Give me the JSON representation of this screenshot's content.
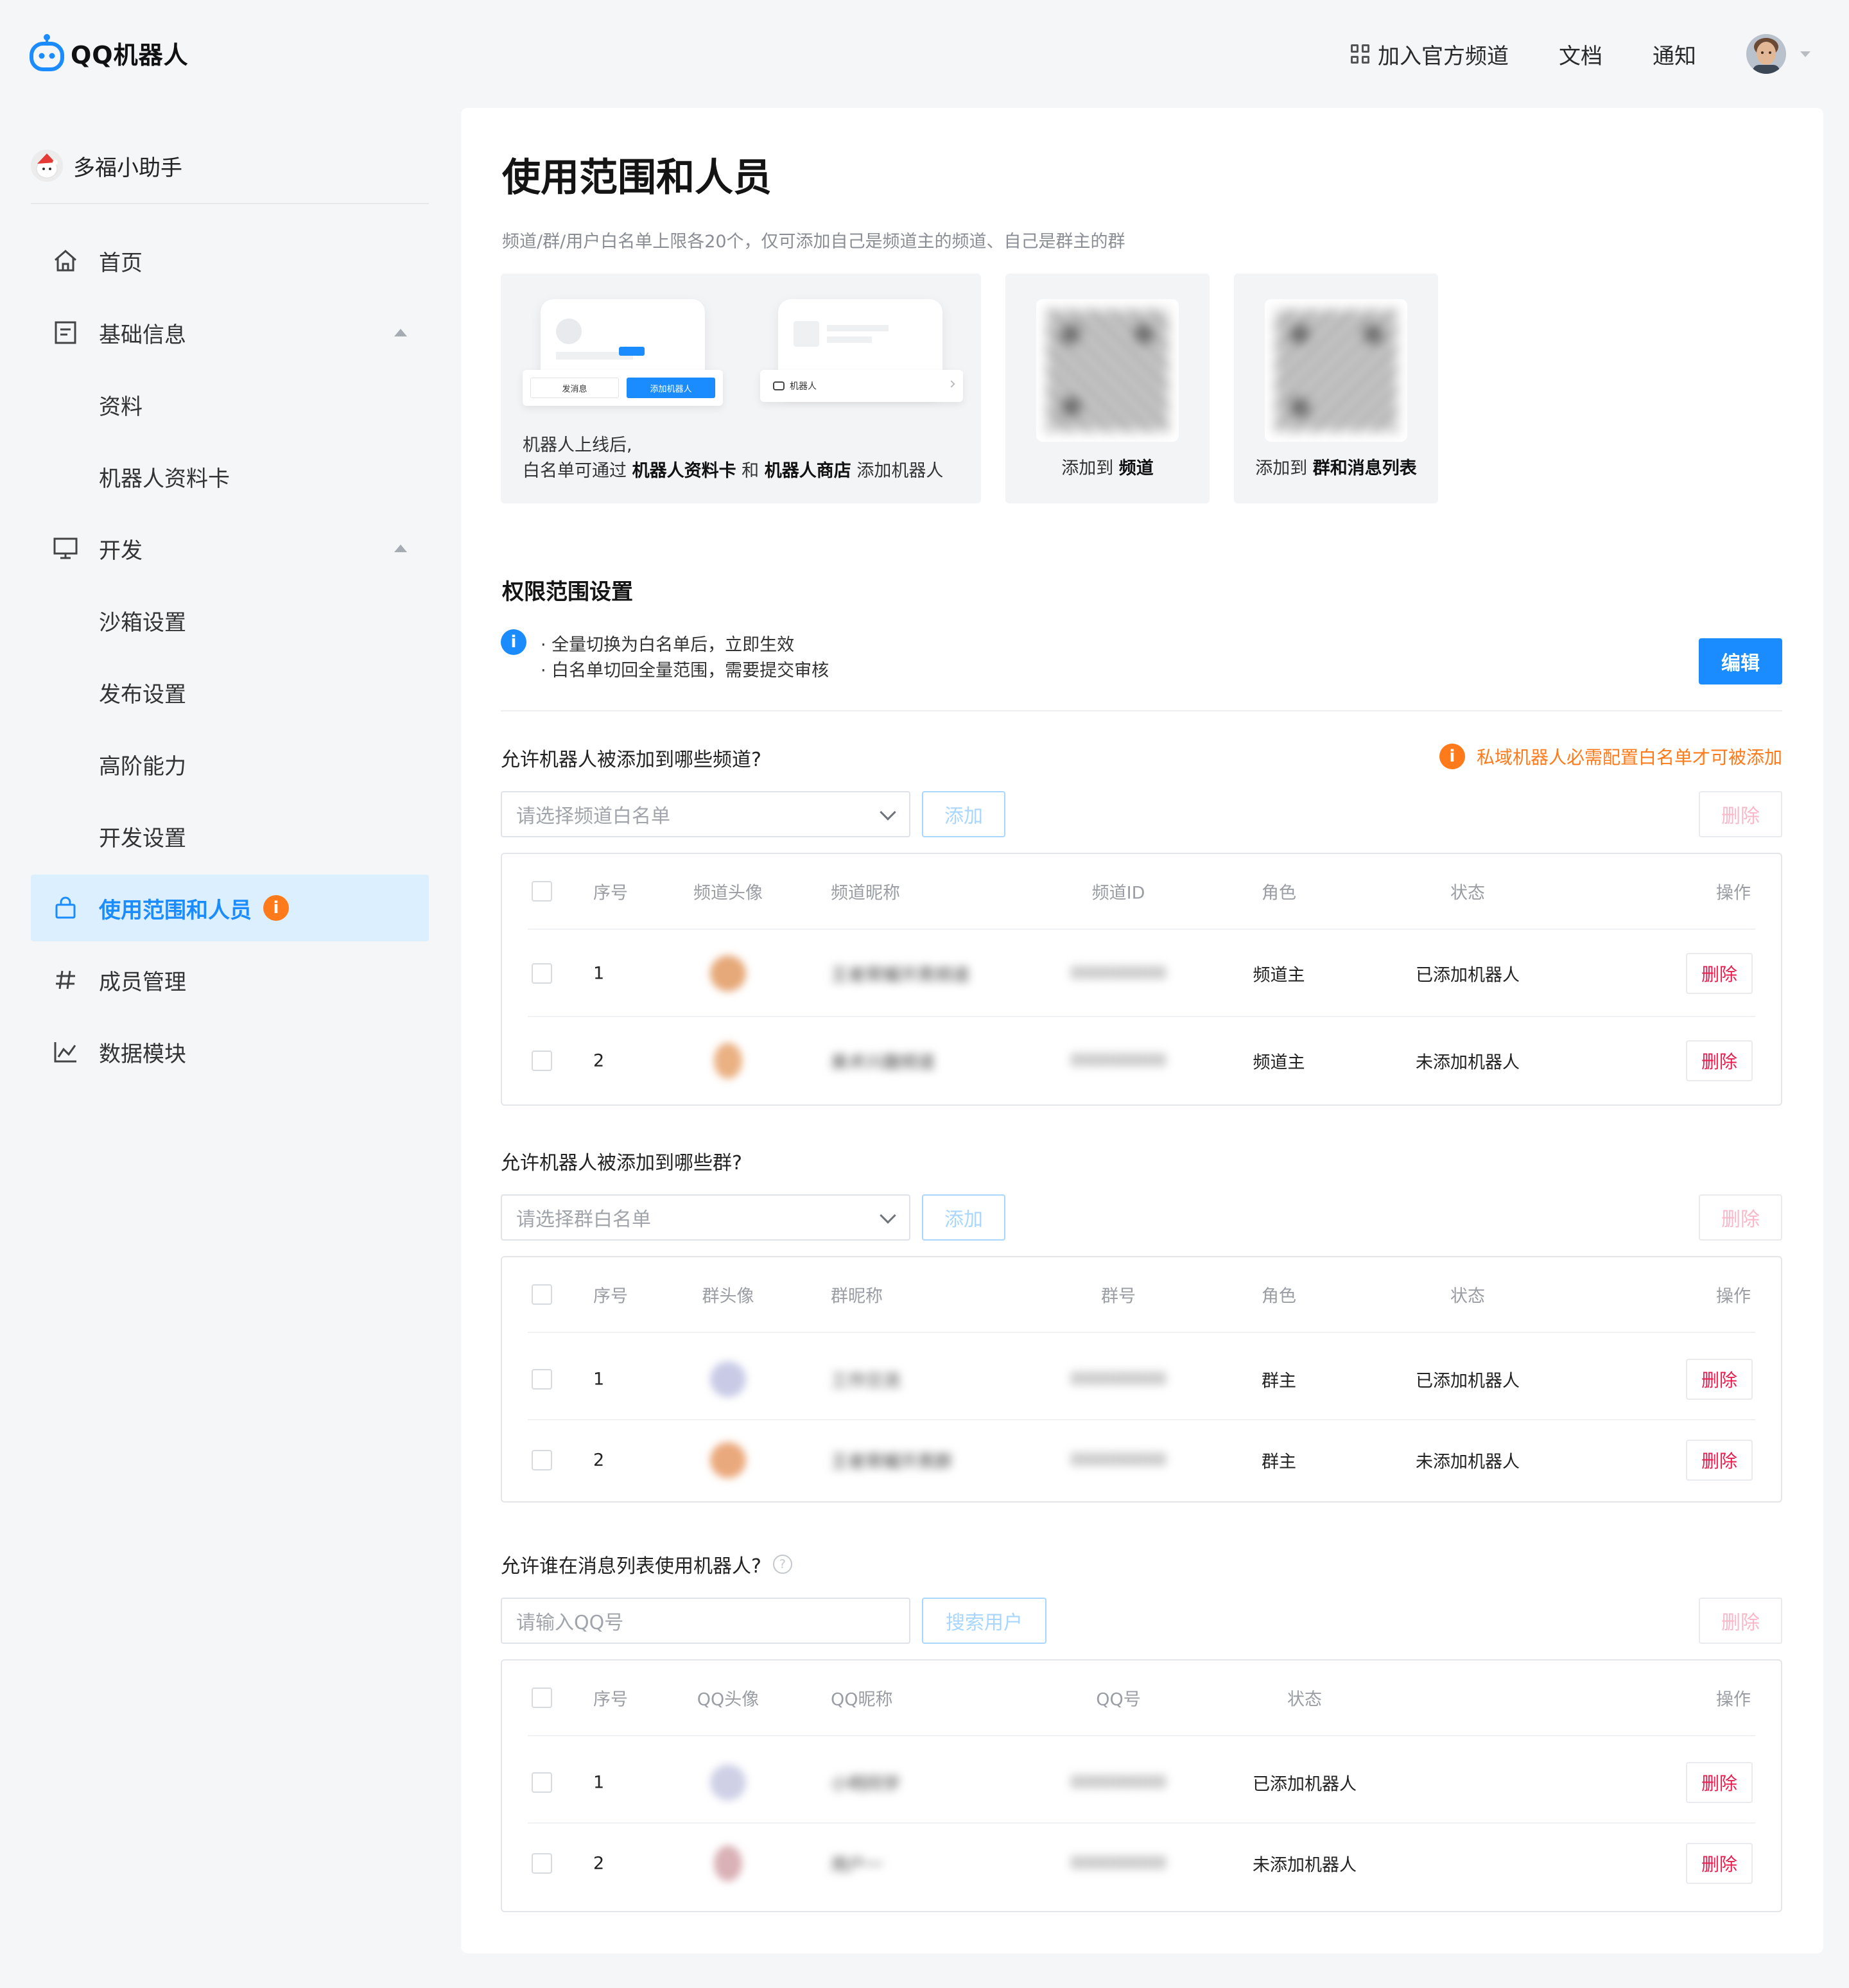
{
  "header": {
    "logo_text": "QQ机器人",
    "nav": {
      "join_channel": "加入官方频道",
      "docs": "文档",
      "notify": "通知"
    }
  },
  "sidebar": {
    "bot_name": "多福小助手",
    "items": [
      {
        "label": "首页",
        "icon": "home-icon"
      },
      {
        "label": "基础信息",
        "icon": "document-icon",
        "expanded": true
      },
      {
        "label": "资料",
        "sub": true
      },
      {
        "label": "机器人资料卡",
        "sub": true
      },
      {
        "label": "开发",
        "icon": "monitor-icon",
        "expanded": true
      },
      {
        "label": "沙箱设置",
        "sub": true
      },
      {
        "label": "发布设置",
        "sub": true
      },
      {
        "label": "高阶能力",
        "sub": true
      },
      {
        "label": "开发设置",
        "sub": true
      },
      {
        "label": "使用范围和人员",
        "icon": "bag-icon",
        "active": true,
        "badge": "i"
      },
      {
        "label": "成员管理",
        "icon": "hash-icon"
      },
      {
        "label": "数据模块",
        "icon": "chart-icon"
      }
    ]
  },
  "page": {
    "title": "使用范围和人员",
    "note": "频道/群/用户白名单上限各20个，仅可添加自己是频道主的频道、自己是群主的群",
    "guide": {
      "line1": "机器人上线后,",
      "line2_pre": "白名单可通过 ",
      "line2_b1": "机器人资料卡",
      "line2_mid": " 和 ",
      "line2_b2": "机器人商店",
      "line2_post": " 添加机器人",
      "mock_send": "发消息",
      "mock_add": "添加机器人",
      "mock_bot": "机器人",
      "qr1_pre": "添加到 ",
      "qr1_b": "频道",
      "qr2_pre": "添加到 ",
      "qr2_b": "群和消息列表"
    },
    "perm": {
      "title": "权限范围设置",
      "info1": "· 全量切换为白名单后，立即生效",
      "info2": "· 白名单切回全量范围，需要提交审核",
      "edit": "编辑"
    }
  },
  "channel_section": {
    "question": "允许机器人被添加到哪些频道?",
    "warning": "私域机器人必需配置白名单才可被添加",
    "select_placeholder": "请选择频道白名单",
    "add": "添加",
    "delete": "删除",
    "columns": [
      "序号",
      "频道头像",
      "频道昵称",
      "频道ID",
      "角色",
      "状态",
      "操作"
    ],
    "rows": [
      {
        "idx": "1",
        "nick": "王者荣耀开黑频道",
        "id": "000000000",
        "role": "频道主",
        "status": "已添加机器人",
        "op": "删除"
      },
      {
        "idx": "2",
        "nick": "美术兴趣频道",
        "id": "000000000",
        "role": "频道主",
        "status": "未添加机器人",
        "op": "删除"
      }
    ]
  },
  "group_section": {
    "question": "允许机器人被添加到哪些群?",
    "select_placeholder": "请选择群白名单",
    "add": "添加",
    "delete": "删除",
    "columns": [
      "序号",
      "群头像",
      "群昵称",
      "群号",
      "角色",
      "状态",
      "操作"
    ],
    "rows": [
      {
        "idx": "1",
        "nick": "工作交流",
        "id": "000000000",
        "role": "群主",
        "status": "已添加机器人",
        "op": "删除"
      },
      {
        "idx": "2",
        "nick": "王者荣耀开黑群",
        "id": "000000000",
        "role": "群主",
        "status": "未添加机器人",
        "op": "删除"
      }
    ]
  },
  "user_section": {
    "question": "允许谁在消息列表使用机器人?",
    "input_placeholder": "请输入QQ号",
    "search": "搜索用户",
    "delete": "删除",
    "columns": [
      "序号",
      "QQ头像",
      "QQ昵称",
      "QQ号",
      "状态",
      "操作"
    ],
    "rows": [
      {
        "idx": "1",
        "nick": "小明同学",
        "id": "000000000",
        "status": "已添加机器人",
        "op": "删除"
      },
      {
        "idx": "2",
        "nick": "用户一",
        "id": "000000000",
        "status": "未添加机器人",
        "op": "删除"
      }
    ]
  },
  "colors": {
    "accent": "#1a8cff",
    "warning": "#ff7a1a",
    "danger": "#e81d4e",
    "active_bg": "#dcefff"
  }
}
